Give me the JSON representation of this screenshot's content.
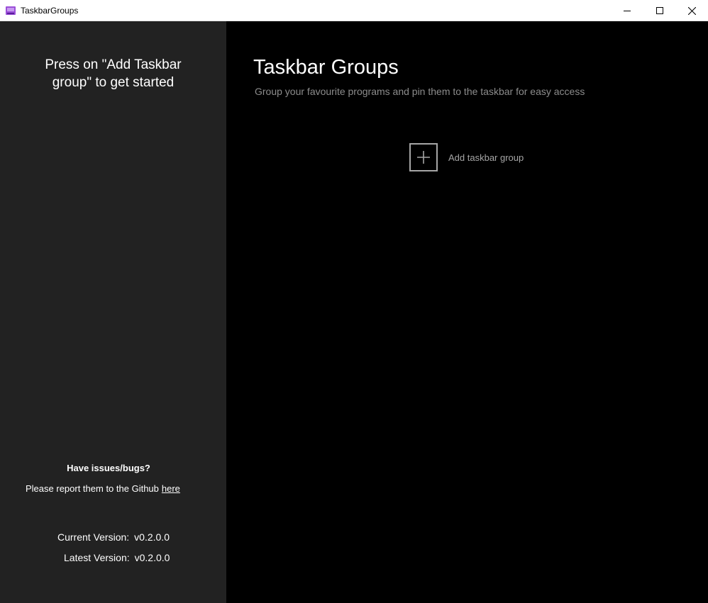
{
  "window": {
    "title": "TaskbarGroups"
  },
  "sidebar": {
    "prompt": "Press on \"Add Taskbar group\" to get started",
    "issues_heading": "Have issues/bugs?",
    "report_text": "Please report them to the Github",
    "report_link": "here",
    "current_version_label": "Current Version:",
    "current_version_value": "v0.2.0.0",
    "latest_version_label": "Latest Version:",
    "latest_version_value": "v0.2.0.0"
  },
  "main": {
    "title": "Taskbar Groups",
    "subtitle": "Group your favourite programs and pin them to the taskbar for easy access",
    "add_button_label": "Add taskbar group"
  },
  "icons": {
    "app": "app-icon",
    "minimize": "minimize-icon",
    "maximize": "maximize-icon",
    "close": "close-icon",
    "add": "plus-icon"
  },
  "colors": {
    "sidebar_bg": "#222222",
    "main_bg": "#000000",
    "subtitle": "#8c8c8c",
    "add_accent": "#a6a6a6"
  }
}
